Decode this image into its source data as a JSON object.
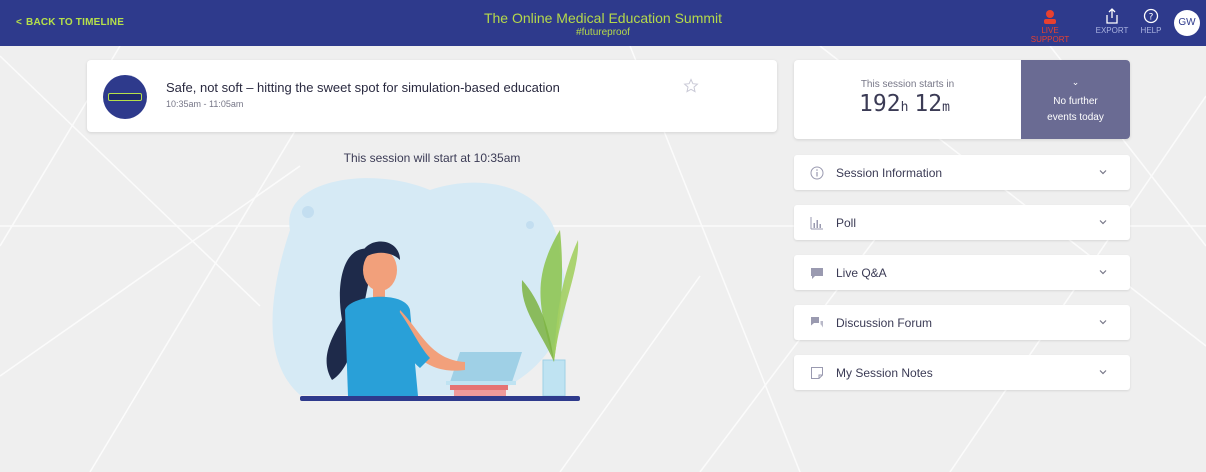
{
  "topbar": {
    "back_label": "BACK TO TIMELINE",
    "event_title": "The Online Medical Education Summit",
    "event_hashtag": "#futureproof",
    "live_support_label": "LIVE SUPPORT",
    "export_label": "EXPORT",
    "help_label": "HELP",
    "user_initials": "GW"
  },
  "session": {
    "title": "Safe, not soft – hitting the sweet spot for simulation-based education",
    "time": "10:35am - 11:05am",
    "start_note": "This session will start at 10:35am"
  },
  "countdown": {
    "label": "This session starts in",
    "hours": "192",
    "hours_unit": "h",
    "minutes": "12",
    "minutes_unit": "m",
    "panel_line1": "No further",
    "panel_line2": "events today"
  },
  "accordion": [
    {
      "label": "Session Information",
      "icon": "info-icon"
    },
    {
      "label": "Poll",
      "icon": "poll-icon"
    },
    {
      "label": "Live Q&A",
      "icon": "chat-bubble-icon"
    },
    {
      "label": "Discussion Forum",
      "icon": "forum-icon"
    },
    {
      "label": "My Session Notes",
      "icon": "notes-icon"
    }
  ],
  "colors": {
    "topbar": "#2e3a8c",
    "accent_green": "#b5e04a",
    "live_red": "#e8402f",
    "countdown_panel": "#6a6b93"
  }
}
